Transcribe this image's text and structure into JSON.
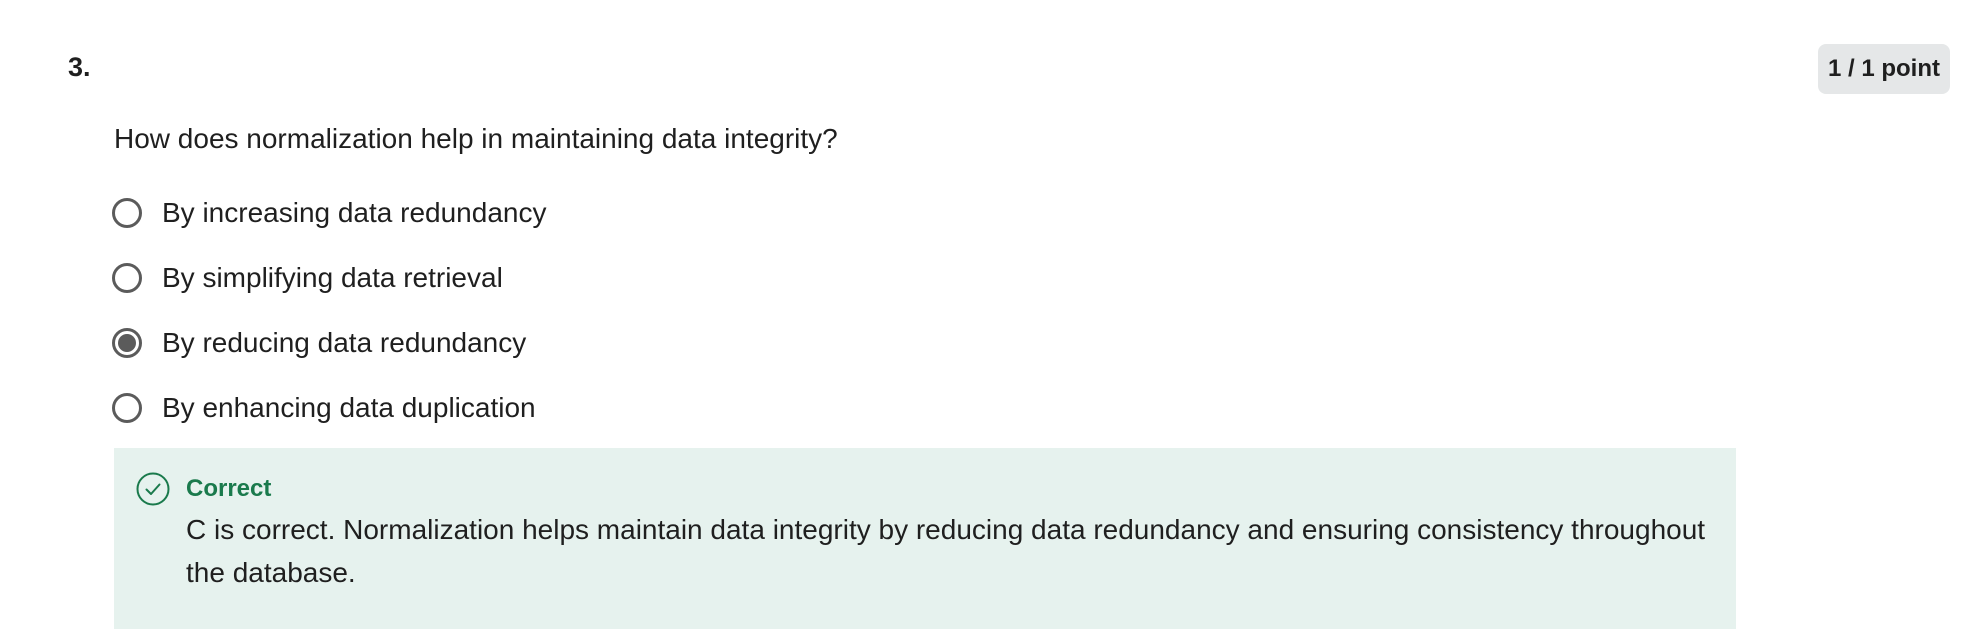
{
  "question": {
    "number": "3.",
    "points": "1 / 1 point",
    "prompt": "How does normalization help in maintaining data integrity?",
    "options": [
      {
        "label": "By increasing data redundancy",
        "selected": false
      },
      {
        "label": "By simplifying data retrieval",
        "selected": false
      },
      {
        "label": "By reducing data redundancy",
        "selected": true
      },
      {
        "label": "By enhancing data duplication",
        "selected": false
      }
    ]
  },
  "feedback": {
    "status": "Correct",
    "icon": "check-circle-icon",
    "text": "C is correct. Normalization helps maintain data integrity by reducing data redundancy and ensuring consistency throughout the database.",
    "color": "#1a7a4c",
    "background": "#e6f2ee"
  }
}
